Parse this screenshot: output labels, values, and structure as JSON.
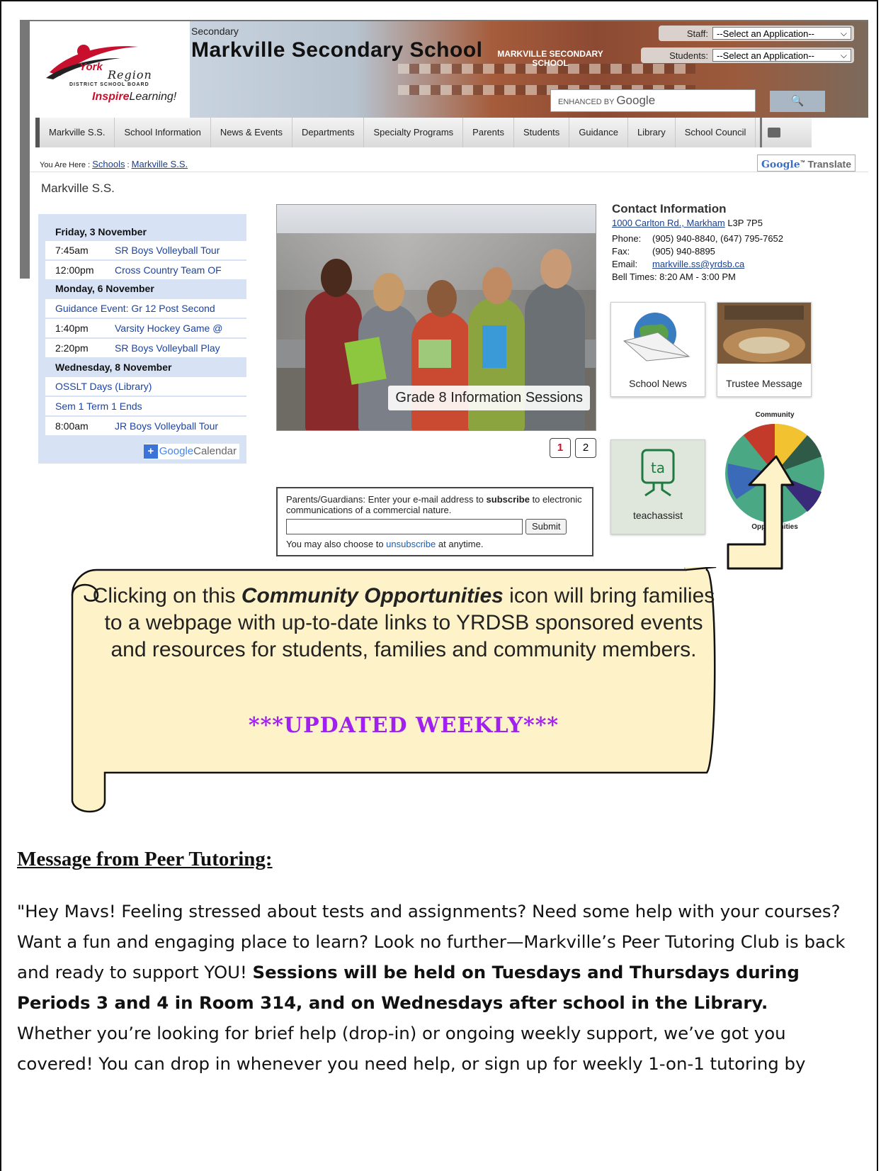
{
  "header": {
    "logo": {
      "york": "York",
      "region": "Region",
      "board": "DISTRICT SCHOOL BOARD",
      "inspire": "Inspire",
      "learning": "Learning!"
    },
    "small_title": "Secondary",
    "school_name": "Markville Secondary School",
    "building_sign": "MARKVILLE SECONDARY SCHOOL",
    "staff_label": "Staff:",
    "staff_select": "--Select an Application--",
    "students_label": "Students:",
    "students_select": "--Select an Application--",
    "search_prefix": "ENHANCED BY",
    "search_brand": "Google",
    "search_button": "🔍"
  },
  "nav": {
    "items": [
      "Markville S.S.",
      "School Information",
      "News & Events",
      "Departments",
      "Specialty Programs",
      "Parents",
      "Students",
      "Guidance",
      "Library",
      "School Council"
    ]
  },
  "breadcrumb": {
    "prefix": "You Are Here :",
    "link1": "Schools",
    "sep": ":",
    "link2": "Markville S.S."
  },
  "translate": {
    "google": "Google",
    "label": "Translate"
  },
  "page_heading": "Markville S.S.",
  "calendar": {
    "rows": [
      {
        "type": "day",
        "text": "Friday, 3 November"
      },
      {
        "type": "event",
        "time": "7:45am",
        "title": "SR Boys Volleyball Tour"
      },
      {
        "type": "event",
        "time": "12:00pm",
        "title": "Cross Country Team OF"
      },
      {
        "type": "day",
        "text": "Monday, 6 November"
      },
      {
        "type": "full",
        "title": "Guidance Event: Gr 12 Post Second"
      },
      {
        "type": "event",
        "time": "1:40pm",
        "title": "Varsity Hockey Game @"
      },
      {
        "type": "event",
        "time": "2:20pm",
        "title": "SR Boys Volleyball Play"
      },
      {
        "type": "day",
        "text": "Wednesday, 8 November"
      },
      {
        "type": "full",
        "title": "OSSLT Days (Library)"
      },
      {
        "type": "full",
        "title": "Sem 1 Term 1 Ends"
      },
      {
        "type": "event",
        "time": "8:00am",
        "title": "JR Boys Volleyball Tour"
      }
    ],
    "gcal_plus": "+",
    "gcal_google": "Google",
    "gcal_label": "Calendar"
  },
  "slideshow": {
    "caption": "Grade 8 Information Sessions",
    "pages": [
      "1",
      "2"
    ],
    "active": 1
  },
  "contact": {
    "heading": "Contact Information",
    "address_link": "1000 Carlton Rd., Markham",
    "postal": "L3P 7P5",
    "phone_label": "Phone:",
    "phone": "(905) 940-8840, (647) 795-7652",
    "fax_label": "Fax:",
    "fax": "(905) 940-8895",
    "email_label": "Email:",
    "email": "markville.ss@yrdsb.ca",
    "bell": "Bell Times: 8:20 AM - 3:00 PM"
  },
  "tiles": {
    "news": "School News",
    "trustee": "Trustee Message",
    "teachassist": "teachassist",
    "ta_logo": "ta",
    "community_top": "Community",
    "community_bottom": "Opportunities"
  },
  "subscribe": {
    "text_a": "Parents/Guardians: Enter your e-mail address to ",
    "text_b": "subscribe",
    "text_c": " to electronic communications of a commercial nature.",
    "submit": "Submit",
    "unsub_a": "You may also choose to ",
    "unsub_link": "unsubscribe",
    "unsub_b": " at anytime."
  },
  "annotation": {
    "line_a": "Clicking on this ",
    "line_b": "Community Opportunities",
    "line_c": " icon will bring families to a webpage with up-to-date links to YRDSB sponsored events and resources for students, families and community members.",
    "updated": "***UPDATED WEEKLY***"
  },
  "message": {
    "heading": "Message from Peer Tutoring:",
    "p1_plain": "\"Hey Mavs! Feeling stressed about tests and assignments? Need some help with your courses? Want a fun and engaging place to learn? Look no further—Markville’s Peer Tutoring Club is back and ready to support YOU! ",
    "p1_bold": "Sessions will be held on Tuesdays and Thursdays during Periods 3 and 4 in Room 314, and on Wednesdays after school in the Library.",
    "p2": "Whether you’re looking for brief help (drop-in) or ongoing weekly support, we’ve got you covered! You can drop in whenever you need help, or sign up for weekly 1-on-1 tutoring by"
  },
  "colors": {
    "accent_red": "#c8102e",
    "link_blue": "#1a3e8c",
    "updated_purple": "#a020f0",
    "scroll_fill": "#fef2c8"
  }
}
